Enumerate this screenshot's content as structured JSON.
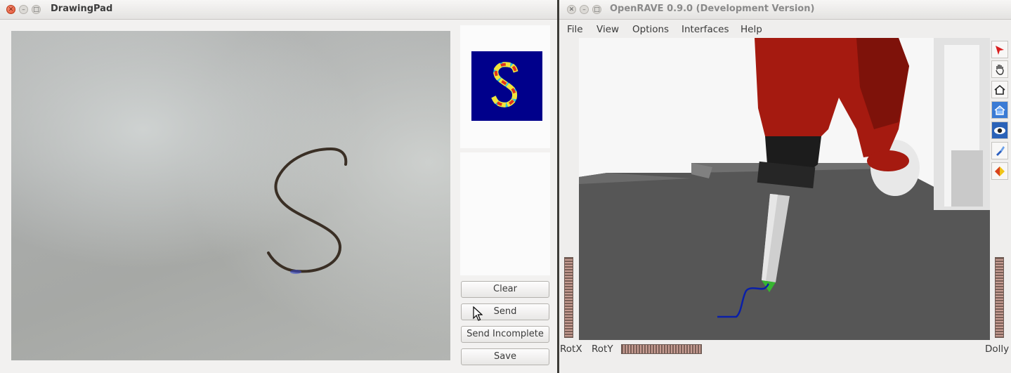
{
  "drawingpad": {
    "title": "DrawingPad",
    "buttons": {
      "clear": "Clear",
      "send": "Send",
      "send_incomplete": "Send Incomplete",
      "save": "Save"
    }
  },
  "openrave": {
    "title": "OpenRAVE 0.9.0 (Development Version)",
    "menu": {
      "file": "File",
      "view": "View",
      "options": "Options",
      "interfaces": "Interfaces",
      "help": "Help"
    },
    "labels": {
      "rotx": "RotX",
      "roty": "RotY",
      "dolly": "Dolly"
    }
  },
  "colors": {
    "camera_bg": "#a9abaa",
    "ink_stroke": "#3a2f25",
    "mnist_bg": "#00008b",
    "robot_red": "#a51a10",
    "trajectory_blue": "#0a1fa8",
    "pen_tip_green": "#37b531"
  },
  "icons": [
    "close-icon",
    "minimize-icon",
    "maximize-icon",
    "pointer-icon",
    "hand-icon",
    "home-icon",
    "home-set-icon",
    "eye-icon",
    "flashlight-icon",
    "shading-icon"
  ]
}
